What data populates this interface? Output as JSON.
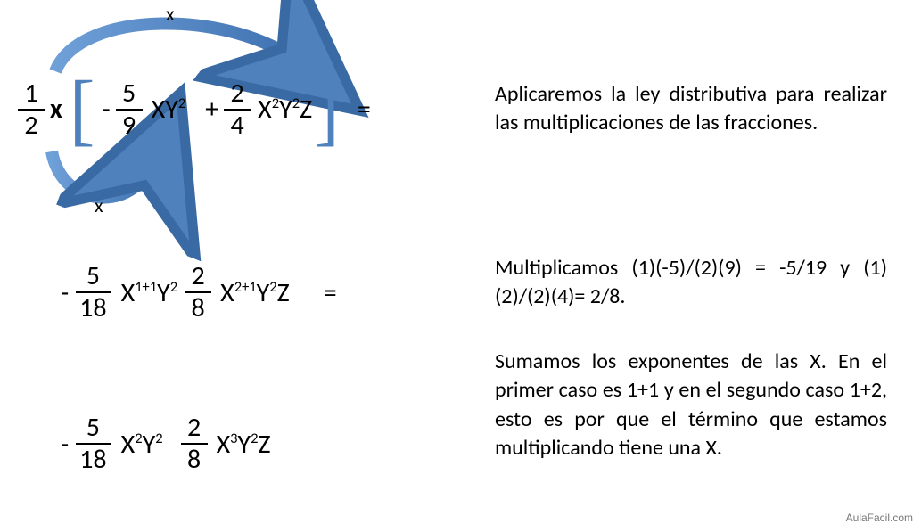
{
  "line1": {
    "outer": {
      "num": "1",
      "den": "2"
    },
    "var_between": "x",
    "term1": {
      "sign": "-",
      "num": "5",
      "den": "9",
      "vars": "XY",
      "exp_after_y": "2"
    },
    "term2": {
      "sign": "+",
      "num": "2",
      "den": "4",
      "vars_seq": [
        {
          "t": "X"
        },
        {
          "e": "2"
        },
        {
          "t": "Y"
        },
        {
          "e": "2"
        },
        {
          "t": "Z"
        }
      ]
    },
    "equals": "="
  },
  "line2": {
    "term1": {
      "sign": "-",
      "num": "5",
      "den": "18",
      "vars_seq": [
        {
          "t": "X"
        },
        {
          "e": "1+1"
        },
        {
          "t": "Y"
        },
        {
          "e": "2"
        }
      ]
    },
    "term2": {
      "num": "2",
      "den": "8",
      "vars_seq": [
        {
          "t": "X"
        },
        {
          "e": "2+1"
        },
        {
          "t": "Y"
        },
        {
          "e": "2"
        },
        {
          "t": "Z"
        }
      ]
    },
    "equals": "="
  },
  "line3": {
    "term1": {
      "sign": "-",
      "num": "5",
      "den": "18",
      "vars_seq": [
        {
          "t": "X"
        },
        {
          "e": "2"
        },
        {
          "t": "Y"
        },
        {
          "e": "2"
        }
      ]
    },
    "term2": {
      "num": "2",
      "den": "8",
      "vars_seq": [
        {
          "t": "X"
        },
        {
          "e": "3"
        },
        {
          "t": "Y"
        },
        {
          "e": "2"
        },
        {
          "t": "Z"
        }
      ]
    }
  },
  "explain1": "Aplicaremos la ley distributiva para realizar las multiplicaciones de las fracciones.",
  "explain2": "Multiplicamos (1)(-5)/(2)(9) = -5/19 y (1)(2)/(2)(4)= 2/8.",
  "explain3": "Sumamos los exponentes de las X. En el primer caso es  1+1 y en el segundo caso  1+2, esto es por que el término que estamos multiplicando tiene una X.",
  "labels": {
    "x_top": "x",
    "x_bottom": "x"
  },
  "watermark": "AulaFacil.com",
  "colors": {
    "arrow": "#4f81bd",
    "arrow_stroke": "#3a6aa3"
  }
}
